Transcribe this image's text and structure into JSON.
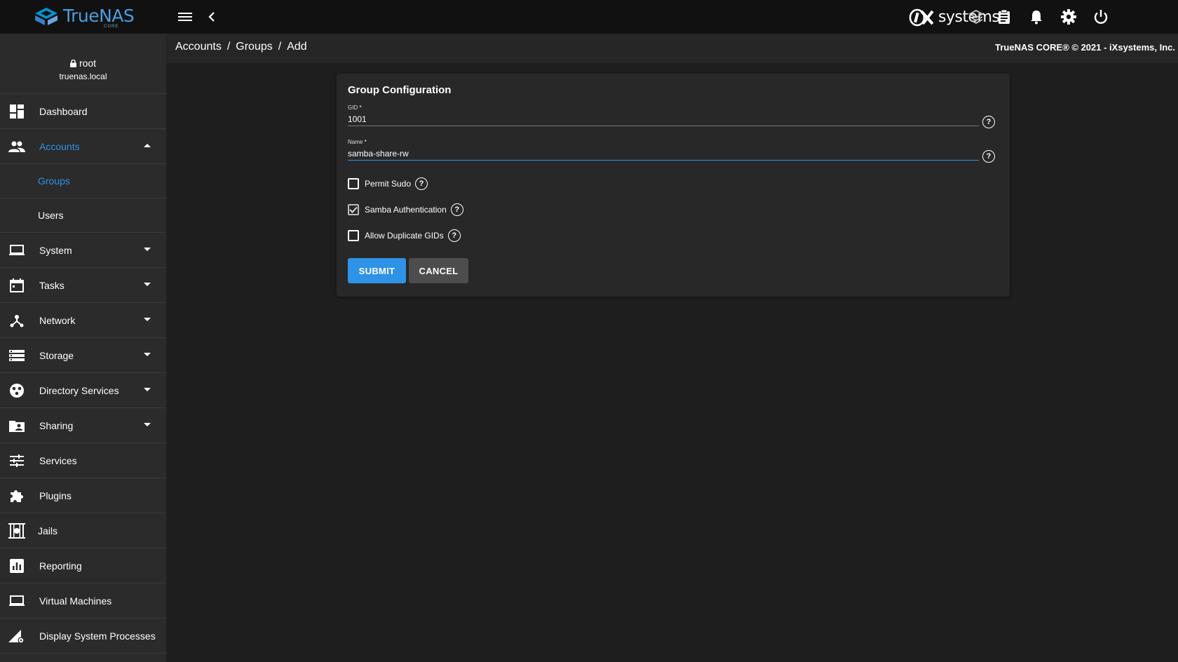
{
  "topbar": {
    "logo_text": "TrueNAS",
    "logo_sub": "CORE",
    "vendor_text": "systems",
    "icons": [
      "menu-icon",
      "chevron-left-icon",
      "truecommand-icon",
      "clipboard-icon",
      "bell-icon",
      "gear-icon",
      "power-icon"
    ]
  },
  "user": {
    "name": "root",
    "host": "truenas.local"
  },
  "sidebar": {
    "items": [
      {
        "label": "Dashboard",
        "icon": "dashboard-icon"
      },
      {
        "label": "Accounts",
        "icon": "people-icon",
        "expanded": true,
        "active": true
      },
      {
        "label": "Groups",
        "sub": true,
        "active": true
      },
      {
        "label": "Users",
        "sub": true
      },
      {
        "label": "System",
        "icon": "laptop-icon"
      },
      {
        "label": "Tasks",
        "icon": "calendar-icon"
      },
      {
        "label": "Network",
        "icon": "network-icon"
      },
      {
        "label": "Storage",
        "icon": "storage-icon"
      },
      {
        "label": "Directory Services",
        "icon": "directory-icon"
      },
      {
        "label": "Sharing",
        "icon": "folder-share-icon"
      },
      {
        "label": "Services",
        "icon": "tune-icon"
      },
      {
        "label": "Plugins",
        "icon": "puzzle-icon"
      },
      {
        "label": "Jails",
        "icon": "jail-icon"
      },
      {
        "label": "Reporting",
        "icon": "chart-icon"
      },
      {
        "label": "Virtual Machines",
        "icon": "laptop-icon"
      },
      {
        "label": "Display System Processes",
        "icon": "processes-icon"
      }
    ]
  },
  "breadcrumb": {
    "items": [
      "Accounts",
      "Groups",
      "Add"
    ],
    "separator": "/"
  },
  "copyright": "TrueNAS CORE® © 2021 - iXsystems, Inc.",
  "form": {
    "title": "Group Configuration",
    "gid": {
      "label": "GID",
      "required_mark": "*",
      "value": "1001"
    },
    "name": {
      "label": "Name",
      "required_mark": "*",
      "value": "samba-share-rw"
    },
    "permit_sudo": {
      "label": "Permit Sudo",
      "checked": false
    },
    "samba_auth": {
      "label": "Samba Authentication",
      "checked": true
    },
    "allow_dup": {
      "label": "Allow Duplicate GIDs",
      "checked": false
    },
    "help_glyph": "?",
    "submit_label": "SUBMIT",
    "cancel_label": "CANCEL"
  },
  "colors": {
    "accent": "#2e92e6",
    "topbar": "#111111",
    "sidebar": "#2b2b2b",
    "background": "#1e1e1e",
    "card": "#282828"
  }
}
